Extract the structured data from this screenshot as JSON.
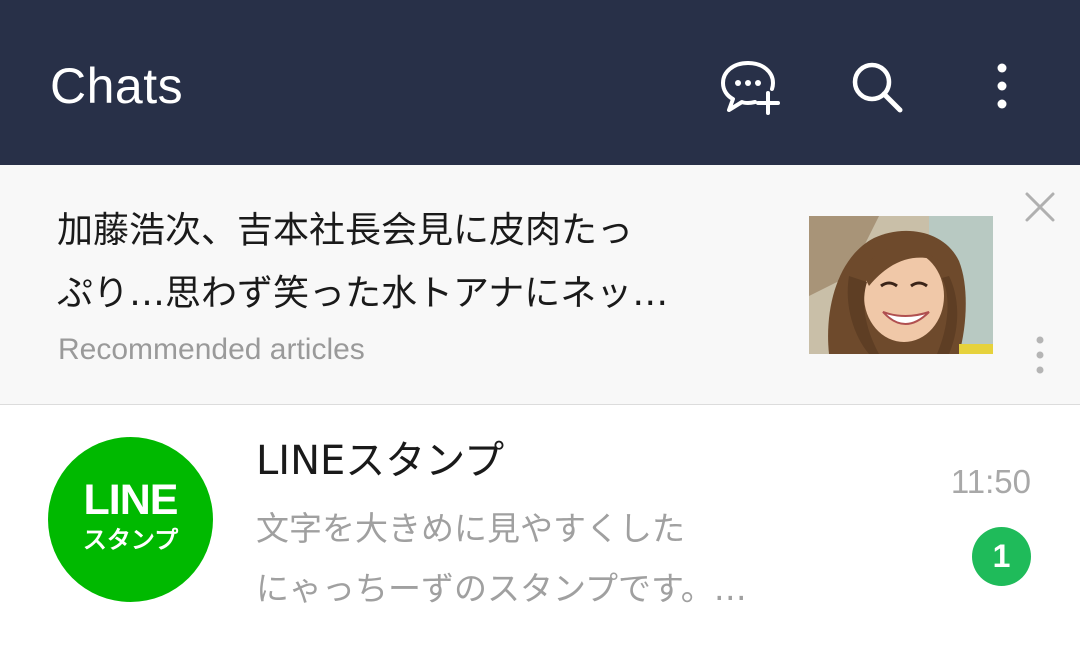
{
  "header": {
    "title": "Chats",
    "background": "#283048",
    "icons": [
      "add-chat-icon",
      "search-icon",
      "more-vertical-icon"
    ]
  },
  "recommended": {
    "title_line1": "加藤浩次、吉本社長会見に皮肉たっ",
    "title_line2": "ぷり…思わず笑った水トアナにネッ…",
    "subtitle": "Recommended articles",
    "icons": [
      "close-icon",
      "more-vertical-icon"
    ]
  },
  "chats": [
    {
      "avatar_line1": "LINE",
      "avatar_line2": "スタンプ",
      "avatar_color": "#00b900",
      "name": "LINEスタンプ",
      "preview_line1": "文字を大きめに見やすくした",
      "preview_line2": "にゃっちーずのスタンプです。…",
      "time": "11:50",
      "unread_count": "1",
      "badge_color": "#1fbb5a"
    }
  ]
}
